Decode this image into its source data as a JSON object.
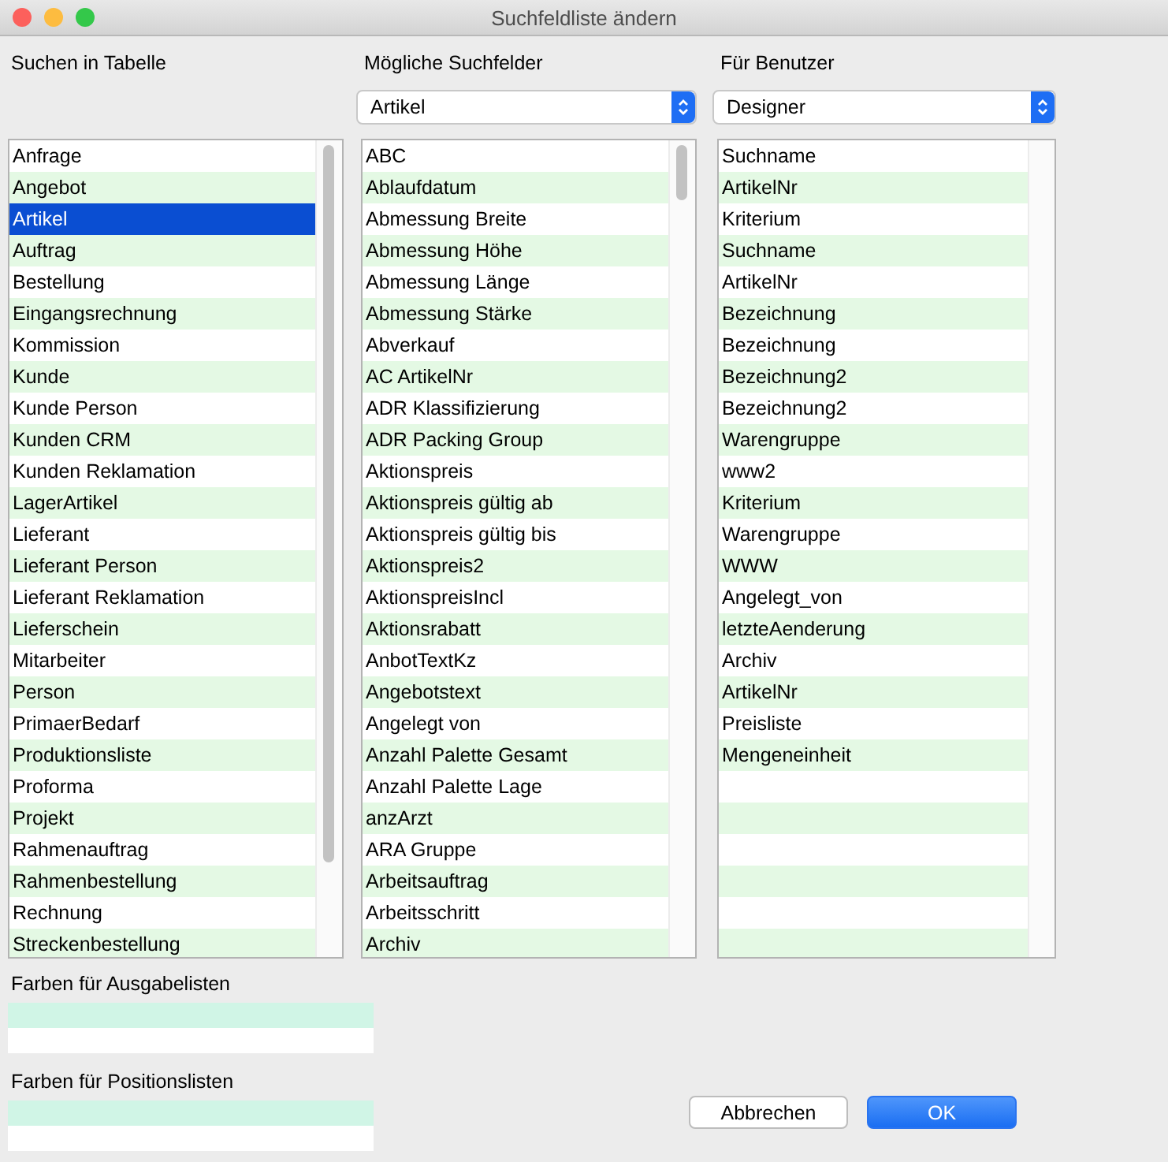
{
  "window": {
    "title": "Suchfeldliste ändern"
  },
  "columns": [
    {
      "label": "Suchen in Tabelle",
      "items": [
        {
          "text": "Anfrage",
          "selected": false
        },
        {
          "text": "Angebot",
          "selected": false
        },
        {
          "text": "Artikel",
          "selected": true
        },
        {
          "text": "Auftrag",
          "selected": false
        },
        {
          "text": "Bestellung",
          "selected": false
        },
        {
          "text": "Eingangsrechnung",
          "selected": false
        },
        {
          "text": "Kommission",
          "selected": false
        },
        {
          "text": "Kunde",
          "selected": false
        },
        {
          "text": "Kunde Person",
          "selected": false
        },
        {
          "text": "Kunden CRM",
          "selected": false
        },
        {
          "text": "Kunden Reklamation",
          "selected": false
        },
        {
          "text": "LagerArtikel",
          "selected": false
        },
        {
          "text": "Lieferant",
          "selected": false
        },
        {
          "text": "Lieferant Person",
          "selected": false
        },
        {
          "text": "Lieferant Reklamation",
          "selected": false
        },
        {
          "text": "Lieferschein",
          "selected": false
        },
        {
          "text": "Mitarbeiter",
          "selected": false
        },
        {
          "text": "Person",
          "selected": false
        },
        {
          "text": "PrimaerBedarf",
          "selected": false
        },
        {
          "text": "Produktionsliste",
          "selected": false
        },
        {
          "text": "Proforma",
          "selected": false
        },
        {
          "text": "Projekt",
          "selected": false
        },
        {
          "text": "Rahmenauftrag",
          "selected": false
        },
        {
          "text": "Rahmenbestellung",
          "selected": false
        },
        {
          "text": "Rechnung",
          "selected": false
        },
        {
          "text": "Streckenbestellung",
          "selected": false
        }
      ]
    },
    {
      "label": "Mögliche Suchfelder",
      "dropdown": "Artikel",
      "items": [
        {
          "text": "ABC",
          "selected": false
        },
        {
          "text": "Ablaufdatum",
          "selected": false
        },
        {
          "text": "Abmessung Breite",
          "selected": false
        },
        {
          "text": "Abmessung Höhe",
          "selected": false
        },
        {
          "text": "Abmessung Länge",
          "selected": false
        },
        {
          "text": "Abmessung Stärke",
          "selected": false
        },
        {
          "text": "Abverkauf",
          "selected": false
        },
        {
          "text": "AC ArtikelNr",
          "selected": false
        },
        {
          "text": "ADR Klassifizierung",
          "selected": false
        },
        {
          "text": "ADR Packing Group",
          "selected": false
        },
        {
          "text": "Aktionspreis",
          "selected": false
        },
        {
          "text": "Aktionspreis gültig ab",
          "selected": false
        },
        {
          "text": "Aktionspreis gültig bis",
          "selected": false
        },
        {
          "text": "Aktionspreis2",
          "selected": false
        },
        {
          "text": "AktionspreisIncl",
          "selected": false
        },
        {
          "text": "Aktionsrabatt",
          "selected": false
        },
        {
          "text": "AnbotTextKz",
          "selected": false
        },
        {
          "text": "Angebotstext",
          "selected": false
        },
        {
          "text": "Angelegt von",
          "selected": false
        },
        {
          "text": "Anzahl Palette Gesamt",
          "selected": false
        },
        {
          "text": "Anzahl Palette Lage",
          "selected": false
        },
        {
          "text": "anzArzt",
          "selected": false
        },
        {
          "text": "ARA Gruppe",
          "selected": false
        },
        {
          "text": "Arbeitsauftrag",
          "selected": false
        },
        {
          "text": "Arbeitsschritt",
          "selected": false
        },
        {
          "text": "Archiv",
          "selected": false
        }
      ]
    },
    {
      "label": "Für Benutzer",
      "dropdown": "Designer",
      "items": [
        {
          "text": "Suchname",
          "selected": false
        },
        {
          "text": "ArtikelNr",
          "selected": false
        },
        {
          "text": "Kriterium",
          "selected": false
        },
        {
          "text": "Suchname",
          "selected": false
        },
        {
          "text": "ArtikelNr",
          "selected": false
        },
        {
          "text": "Bezeichnung",
          "selected": false
        },
        {
          "text": "Bezeichnung",
          "selected": false
        },
        {
          "text": "Bezeichnung2",
          "selected": false
        },
        {
          "text": "Bezeichnung2",
          "selected": false
        },
        {
          "text": "Warengruppe",
          "selected": false
        },
        {
          "text": "www2",
          "selected": false
        },
        {
          "text": "Kriterium",
          "selected": false
        },
        {
          "text": "Warengruppe",
          "selected": false
        },
        {
          "text": "WWW",
          "selected": false
        },
        {
          "text": "Angelegt_von",
          "selected": false
        },
        {
          "text": "letzteAenderung",
          "selected": false
        },
        {
          "text": "Archiv",
          "selected": false
        },
        {
          "text": "ArtikelNr",
          "selected": false
        },
        {
          "text": "Preisliste",
          "selected": false
        },
        {
          "text": "Mengeneinheit",
          "selected": false
        }
      ]
    }
  ],
  "color_sets": [
    {
      "label": "Farben für Ausgabelisten",
      "colors": [
        {
          "color": "#d0f5e6"
        },
        {
          "color": "#ffffff"
        }
      ]
    },
    {
      "label": "Farben für Positionslisten",
      "colors": [
        {
          "color": "#d0f5e6"
        },
        {
          "color": "#ffffff"
        }
      ]
    }
  ],
  "buttons": [
    {
      "label": "Abbrechen",
      "kind": "cancel"
    },
    {
      "label": "OK",
      "kind": "default"
    }
  ]
}
